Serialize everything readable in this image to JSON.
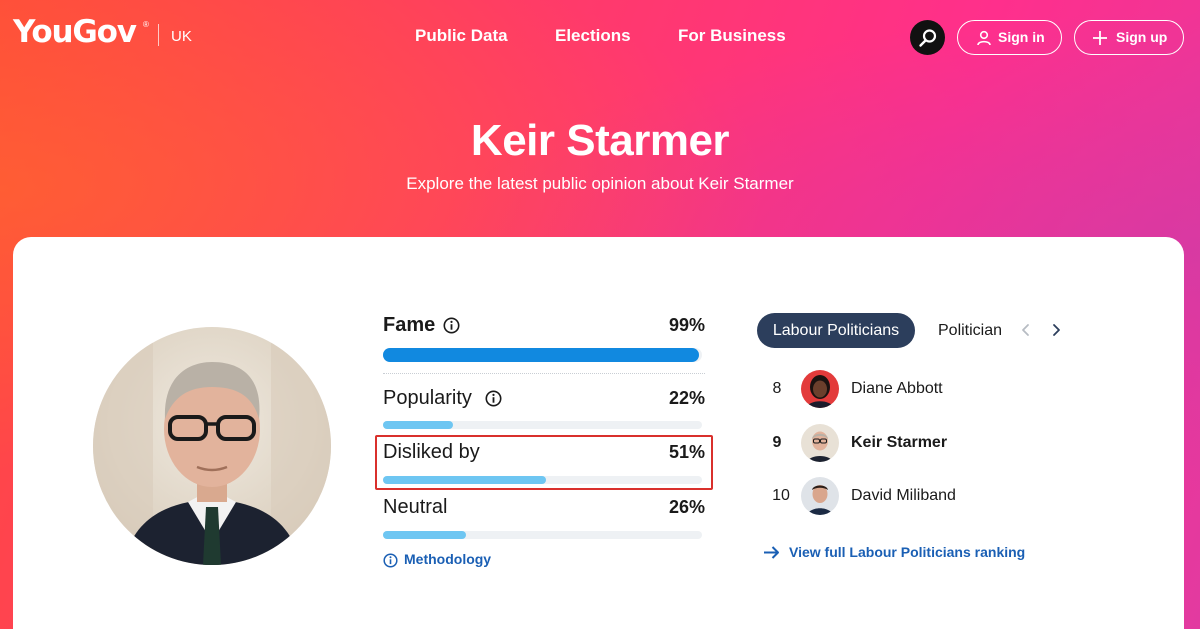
{
  "header": {
    "logo_text": "YouGov",
    "logo_mark": "®",
    "region": "UK",
    "nav": [
      "Public Data",
      "Elections",
      "For Business"
    ],
    "search_icon": "search-icon",
    "sign_in": "Sign in",
    "sign_up": "Sign up"
  },
  "hero": {
    "title": "Keir Starmer",
    "subtitle": "Explore the latest public opinion about Keir Starmer"
  },
  "metrics": [
    {
      "label": "Fame",
      "value": "99%",
      "fraction": 0.99,
      "color": "#1189e0",
      "info": true
    },
    {
      "label": "Popularity",
      "value": "22%",
      "fraction": 0.22,
      "color": "#6ec6f2",
      "info": true
    },
    {
      "label": "Disliked by",
      "value": "51%",
      "fraction": 0.51,
      "color": "#6ec6f2",
      "info": false
    },
    {
      "label": "Neutral",
      "value": "26%",
      "fraction": 0.26,
      "color": "#6ec6f2",
      "info": false
    }
  ],
  "methodology": "Methodology",
  "ranking": {
    "tabs": [
      "Labour Politicians",
      "Politician"
    ],
    "items": [
      {
        "rank": "8",
        "name": "Diane Abbott",
        "current": false
      },
      {
        "rank": "9",
        "name": "Keir Starmer",
        "current": true
      },
      {
        "rank": "10",
        "name": "David Miliband",
        "current": false
      }
    ],
    "view_full": "View full Labour Politicians ranking"
  },
  "colors": {
    "accent_navy": "#2c3e5c",
    "link_blue": "#1a5fb4",
    "highlight_red": "#d9302c",
    "fame_bar": "#1189e0",
    "light_bar": "#6ec6f2"
  }
}
